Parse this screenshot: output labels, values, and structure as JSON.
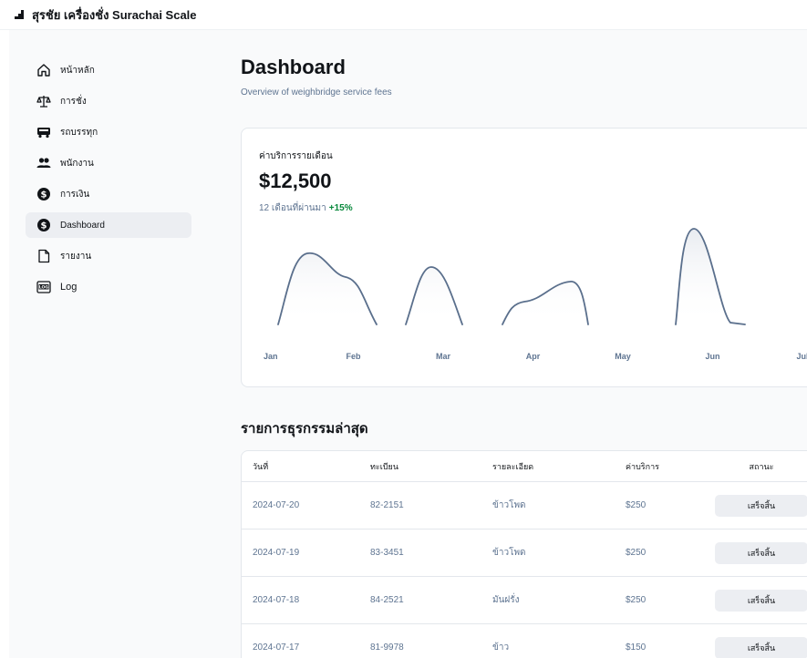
{
  "app": {
    "brand": "สุรชัย เครื่องชั่ง  Surachai Scale"
  },
  "sidebar": {
    "items": [
      {
        "label": "หน้าหลัก",
        "icon": "home-icon"
      },
      {
        "label": "การชั่ง",
        "icon": "scale-icon"
      },
      {
        "label": "รถบรรทุก",
        "icon": "truck-icon"
      },
      {
        "label": "พนักงาน",
        "icon": "users-icon"
      },
      {
        "label": "การเงิน",
        "icon": "currency-icon"
      },
      {
        "label": "Dashboard",
        "icon": "currency-icon",
        "active": true
      },
      {
        "label": "รายงาน",
        "icon": "file-icon"
      },
      {
        "label": "Log",
        "icon": "log-icon"
      }
    ]
  },
  "main": {
    "title": "Dashboard",
    "subtitle": "Overview of weighbridge service fees"
  },
  "card": {
    "label": "ค่าบริการรายเดือน",
    "value": "$12,500",
    "period": "12 เดือนที่ผ่านมา",
    "change": "+15%"
  },
  "chart_data": {
    "type": "line",
    "categories": [
      "Jan",
      "Feb",
      "Mar",
      "Apr",
      "May",
      "Jun",
      "Jul"
    ],
    "color": "#5a6f8c"
  },
  "transactions": {
    "title": "รายการธุรกรรมล่าสุด",
    "headers": [
      "วันที่",
      "ทะเบียน",
      "รายละเอียด",
      "ค่าบริการ",
      "สถานะ"
    ],
    "rows": [
      [
        "2024-07-20",
        "82-2151",
        "ข้าวโพด",
        "$250",
        "เสร็จสิ้น"
      ],
      [
        "2024-07-19",
        "83-3451",
        "ข้าวโพด",
        "$250",
        "เสร็จสิ้น"
      ],
      [
        "2024-07-18",
        "84-2521",
        "มันฝรั่ง",
        "$250",
        "เสร็จสิ้น"
      ],
      [
        "2024-07-17",
        "81-9978",
        "ข้าว",
        "$150",
        "เสร็จสิ้น"
      ]
    ]
  }
}
